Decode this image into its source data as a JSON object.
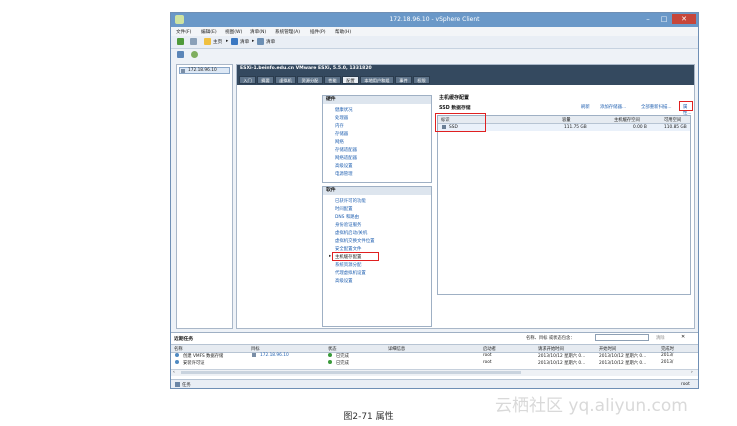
{
  "window": {
    "title": "172.18.96.10 - vSphere Client",
    "controls": [
      "–",
      "□",
      "✕"
    ]
  },
  "menu": [
    "文件(F)",
    "编辑(E)",
    "视图(W)",
    "清单(N)",
    "系统管理(A)",
    "插件(P)",
    "帮助(H)"
  ],
  "nav": {
    "home": "主页",
    "inventory1": "清单",
    "inventory2": "清单"
  },
  "tree": {
    "host": "172.18.96.10"
  },
  "host_header": "ESXi-1.beinfo.edu.cn VMware ESXi, 5.5.0, 1331820",
  "tabs": [
    "入门",
    "摘要",
    "虚拟机",
    "资源分配",
    "性能",
    "配置",
    "本地用户和组",
    "事件",
    "权限"
  ],
  "hardware": {
    "title": "硬件",
    "items": [
      "健康状况",
      "处理器",
      "内存",
      "存储器",
      "网络",
      "存储适配器",
      "网络适配器",
      "高级设置",
      "电源管理"
    ]
  },
  "software": {
    "title": "软件",
    "items": [
      "已获许可的功能",
      "时间配置",
      "DNS 和路由",
      "身份验证服务",
      "虚拟机启动/关机",
      "虚拟机交换文件位置",
      "安全配置文件",
      "主机缓存配置",
      "系统资源分配",
      "代理虚拟机设置",
      "高级设置"
    ],
    "selected": "主机缓存配置"
  },
  "cache_config": {
    "title": "主机缓存配置",
    "subtitle": "SSD 数据存储",
    "actions": [
      "刷新",
      "添加存储器...",
      "全部重新扫描...",
      "属性..."
    ],
    "columns": [
      "标识",
      "容量",
      "主机缓存空间",
      "可用空间"
    ],
    "rows": [
      {
        "name": "SSD",
        "capacity": "111.75 GB",
        "cache": "0.00 B",
        "free": "110.85 GB"
      }
    ]
  },
  "recent_tasks": {
    "title": "近期任务",
    "filter_label": "名称、目标 或状态包含：",
    "clear_label": "清除",
    "columns": [
      "名称",
      "目标",
      "状态",
      "详细信息",
      "启动者",
      "请求开始时间",
      "开始时间",
      "完成时"
    ],
    "rows": [
      {
        "name": "创建 VMFS 数据存储",
        "target": "172.18.96.10",
        "status": "已完成",
        "details": "",
        "initiator": "root",
        "requested": "2013/10/12 星期六 0...",
        "started": "2013/10/12 星期六 0...",
        "completed": "2013/"
      },
      {
        "name": "安装许可证",
        "target": "",
        "status": "已完成",
        "details": "",
        "initiator": "root",
        "requested": "2013/10/12 星期六 0...",
        "started": "2013/10/12 星期六 0...",
        "completed": "2013/"
      }
    ]
  },
  "statusbar": {
    "tasks": "任务",
    "user": "root"
  },
  "caption": "图2-71 属性",
  "watermark": "云栖社区 yq.aliyun.com"
}
